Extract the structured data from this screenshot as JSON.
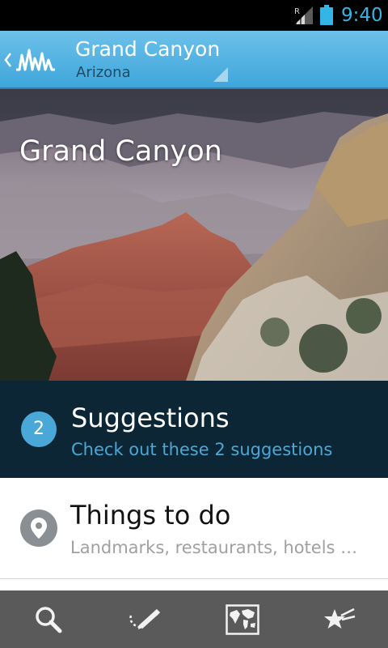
{
  "status_bar": {
    "time": "9:40",
    "roaming_indicator": "R",
    "icons": [
      "signal-icon",
      "battery-icon"
    ],
    "accent_color": "#33b5e5"
  },
  "action_bar": {
    "title": "Grand Canyon",
    "subtitle": "Arizona",
    "icons": [
      "up-navigation-icon",
      "app-logo-icon",
      "spinner-dropdown-icon"
    ],
    "color": "#4fb0e0"
  },
  "hero": {
    "title": "Grand Canyon"
  },
  "suggestions": {
    "count": "2",
    "title": "Suggestions",
    "subtitle": "Check out these 2 suggestions",
    "background_color": "#0d2635",
    "accent_color": "#4aa8d8"
  },
  "things_to_do": {
    "title": "Things to do",
    "subtitle": "Landmarks, restaurants, hotels …",
    "icon": "location-pin-icon"
  },
  "bottom_nav": {
    "items": [
      {
        "icon": "search-icon"
      },
      {
        "icon": "edit-trip-icon"
      },
      {
        "icon": "world-map-icon"
      },
      {
        "icon": "favorites-star-icon"
      }
    ],
    "background_color": "#5a5a5a"
  }
}
